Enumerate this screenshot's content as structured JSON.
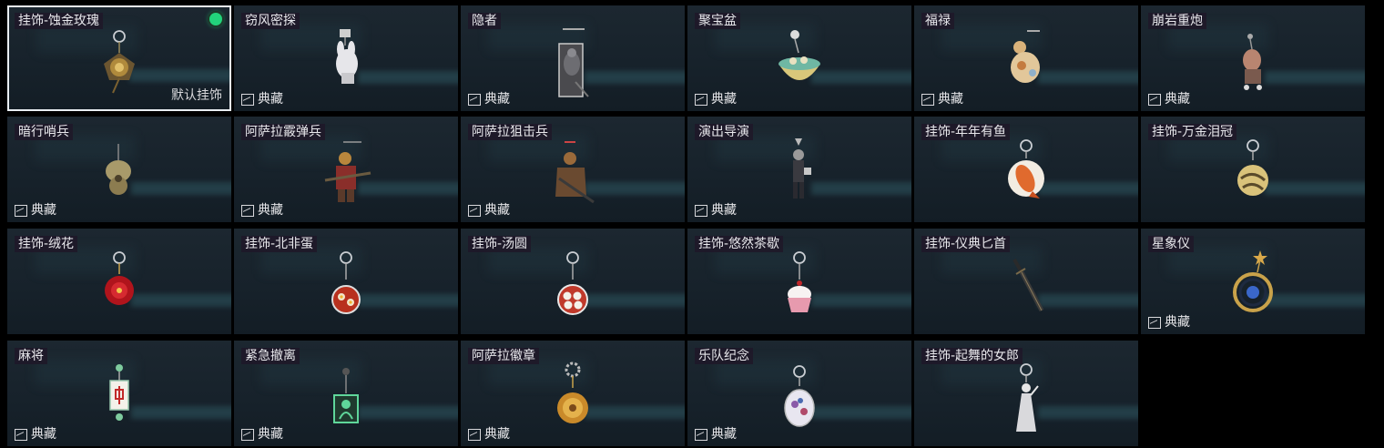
{
  "collection_tag": "典藏",
  "default_label": "默认挂饰",
  "accent_color": "#22d37b",
  "items": [
    {
      "name": "挂饰-蚀金玫瑰",
      "selected": true,
      "equipped": true,
      "is_default": true,
      "collection": false,
      "icon": "gold-rose-charm"
    },
    {
      "name": "窃风密探",
      "collection": true,
      "icon": "rabbit-spy-charm"
    },
    {
      "name": "隐者",
      "collection": true,
      "icon": "hermit-charm"
    },
    {
      "name": "聚宝盆",
      "collection": true,
      "icon": "treasure-bowl-charm"
    },
    {
      "name": "福禄",
      "collection": true,
      "icon": "gourd-charm"
    },
    {
      "name": "崩岩重炮",
      "collection": true,
      "icon": "heavy-gunner-charm"
    },
    {
      "name": "暗行哨兵",
      "collection": true,
      "icon": "shadow-sentry-charm"
    },
    {
      "name": "阿萨拉霰弹兵",
      "collection": true,
      "icon": "shotgunner-charm"
    },
    {
      "name": "阿萨拉狙击兵",
      "collection": true,
      "icon": "sniper-charm"
    },
    {
      "name": "演出导演",
      "collection": true,
      "icon": "director-charm"
    },
    {
      "name": "挂饰-年年有鱼",
      "collection": false,
      "icon": "fish-charm"
    },
    {
      "name": "挂饰-万金泪冠",
      "collection": false,
      "icon": "gold-crown-charm"
    },
    {
      "name": "挂饰-绒花",
      "collection": false,
      "icon": "velvet-flower-charm"
    },
    {
      "name": "挂饰-北非蛋",
      "collection": false,
      "icon": "shakshuka-charm"
    },
    {
      "name": "挂饰-汤圆",
      "collection": false,
      "icon": "rice-ball-charm"
    },
    {
      "name": "挂饰-悠然茶歇",
      "collection": false,
      "icon": "cupcake-charm"
    },
    {
      "name": "挂饰-仪典匕首",
      "collection": false,
      "icon": "dagger-charm"
    },
    {
      "name": "星象仪",
      "collection": true,
      "icon": "astrolabe-charm"
    },
    {
      "name": "麻将",
      "collection": true,
      "icon": "mahjong-charm"
    },
    {
      "name": "紧急撤离",
      "collection": true,
      "icon": "evacuation-charm"
    },
    {
      "name": "阿萨拉徽章",
      "collection": true,
      "icon": "badge-charm"
    },
    {
      "name": "乐队纪念",
      "collection": true,
      "icon": "band-memento-charm"
    },
    {
      "name": "挂饰-起舞的女郎",
      "collection": false,
      "icon": "dancing-lady-charm"
    }
  ]
}
